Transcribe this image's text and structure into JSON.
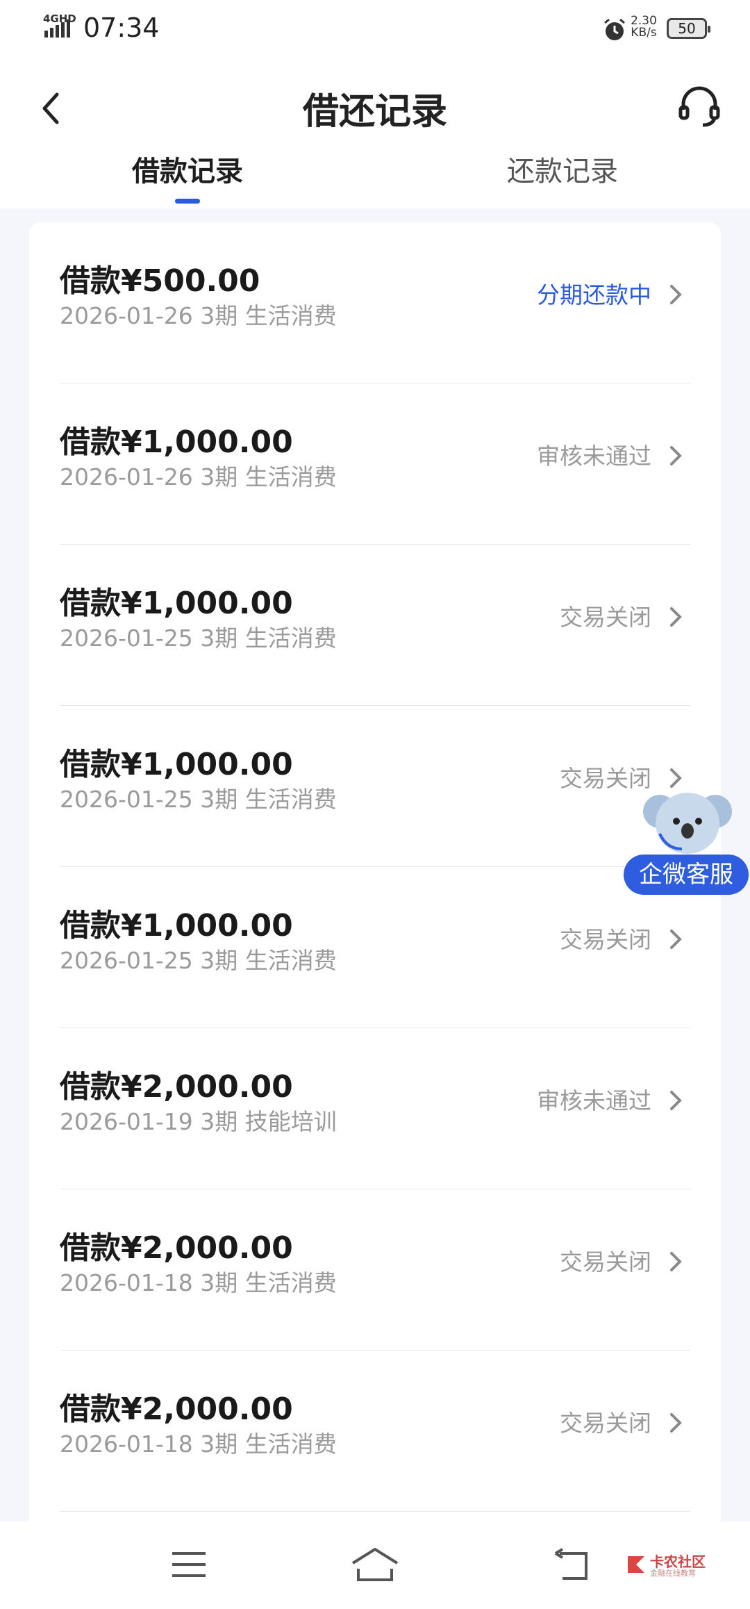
{
  "status_bar": {
    "network": "4GHD",
    "time": "07:34",
    "speed_value": "2.30",
    "speed_unit": "KB/s",
    "battery": "50"
  },
  "header": {
    "title": "借还记录",
    "tabs": [
      {
        "label": "借款记录",
        "active": true
      },
      {
        "label": "还款记录",
        "active": false
      }
    ]
  },
  "records": [
    {
      "amount": "借款¥500.00",
      "detail": "2026-01-26 3期  生活消费",
      "status": "分期还款中",
      "status_color": "#2a5ae0"
    },
    {
      "amount": "借款¥1,000.00",
      "detail": "2026-01-26 3期  生活消费",
      "status": "审核未通过",
      "status_color": "#9a9a9a"
    },
    {
      "amount": "借款¥1,000.00",
      "detail": "2026-01-25 3期  生活消费",
      "status": "交易关闭",
      "status_color": "#9a9a9a"
    },
    {
      "amount": "借款¥1,000.00",
      "detail": "2026-01-25 3期  生活消费",
      "status": "交易关闭",
      "status_color": "#9a9a9a"
    },
    {
      "amount": "借款¥1,000.00",
      "detail": "2026-01-25 3期  生活消费",
      "status": "交易关闭",
      "status_color": "#9a9a9a"
    },
    {
      "amount": "借款¥2,000.00",
      "detail": "2026-01-19 3期  技能培训",
      "status": "审核未通过",
      "status_color": "#9a9a9a"
    },
    {
      "amount": "借款¥2,000.00",
      "detail": "2026-01-18 3期  生活消费",
      "status": "交易关闭",
      "status_color": "#9a9a9a"
    },
    {
      "amount": "借款¥2,000.00",
      "detail": "2026-01-18 3期  生活消费",
      "status": "交易关闭",
      "status_color": "#9a9a9a"
    }
  ],
  "float_service": {
    "label": "企微客服"
  },
  "watermark": {
    "title": "卡农社区",
    "subtitle": "金融在线教育"
  },
  "colors": {
    "accent": "#2a5ae0",
    "muted": "#9a9a9a"
  },
  "icons": {
    "back": "back-arrow-icon",
    "service": "headset-icon",
    "chevron": "chevron-right-icon",
    "nav_menu": "menu-icon",
    "nav_home": "home-icon",
    "nav_back": "return-icon"
  }
}
